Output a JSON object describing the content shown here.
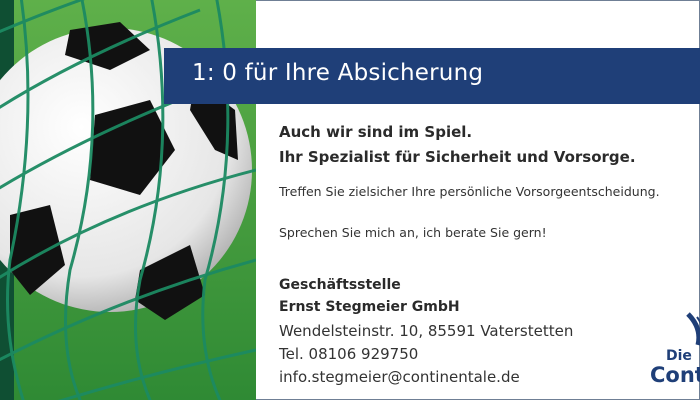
{
  "banner": {
    "headline": "1: 0 für Ihre Absicherung"
  },
  "intro": {
    "line1": "Auch wir sind im Spiel.",
    "line2": "Ihr Spezialist für Sicherheit und Vorsorge."
  },
  "body": {
    "paragraph1": "Treffen Sie zielsicher Ihre persönliche Vorsorgeentscheidung.",
    "paragraph2": "Sprechen Sie mich an, ich berate Sie gern!"
  },
  "contact": {
    "office_label": "Geschäftsstelle",
    "company": "Ernst Stegmeier GmbH",
    "address": "Wendelsteinstr. 10, 85591 Vaterstetten",
    "phone": "Tel. 08106 929750",
    "email": "info.stegmeier@continentale.de"
  },
  "logo": {
    "line1": "Die",
    "line2": "Conti"
  },
  "colors": {
    "banner_bg": "#1f3f78",
    "logo_blue": "#1f3f78",
    "grass": "#3d9a3a",
    "net": "#1c7a5e"
  },
  "icons": {
    "photo": "soccer-ball-in-net-image",
    "logo": "continentale-logo"
  }
}
